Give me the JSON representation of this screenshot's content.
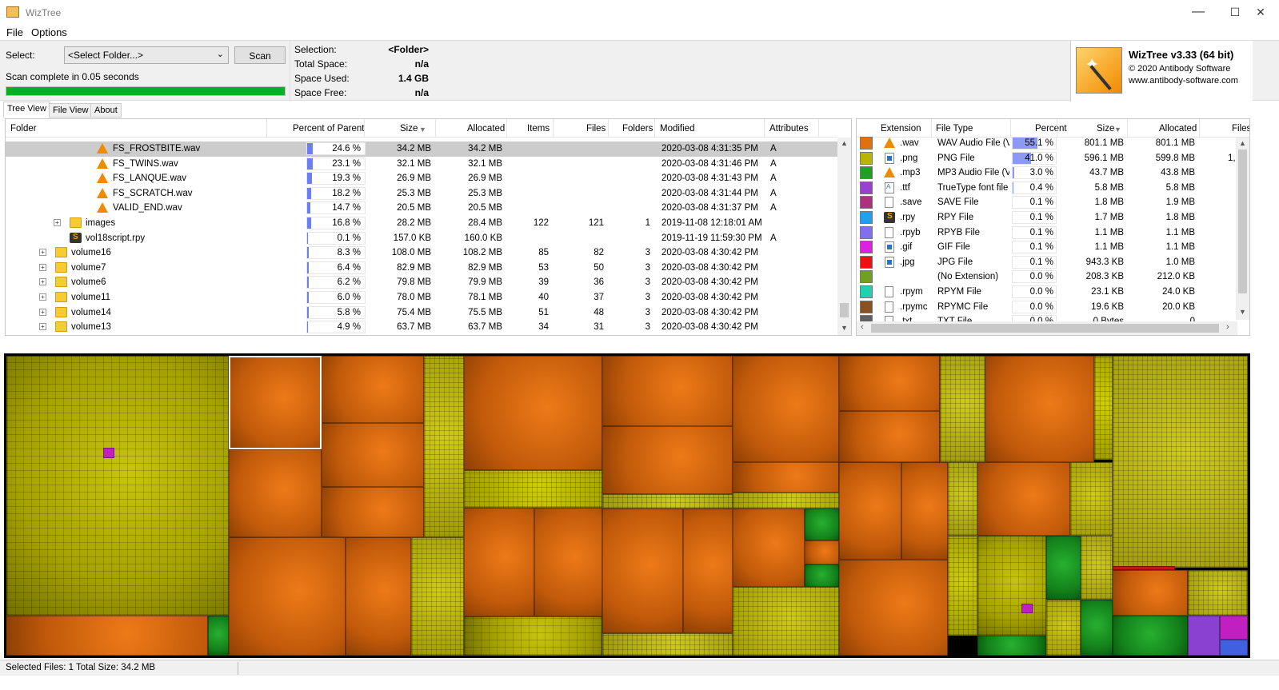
{
  "window": {
    "title": "WizTree",
    "minimize": "—",
    "maximize": "☐",
    "close": "✕"
  },
  "menu": [
    "File",
    "Options"
  ],
  "toolbar": {
    "select_label": "Select:",
    "folder_value": "<Select Folder...>",
    "scan_label": "Scan",
    "status": "Scan complete in 0.05 seconds",
    "progress_fraction": 1.0
  },
  "info": {
    "selection_label": "Selection:",
    "selection_value": "<Folder>",
    "total_label": "Total Space:",
    "total_value": "n/a",
    "used_label": "Space Used:",
    "used_value": "1.4 GB",
    "free_label": "Space Free:",
    "free_value": "n/a"
  },
  "about": {
    "title": "WizTree v3.33 (64 bit)",
    "copyright": "© 2020 Antibody Software",
    "url": "www.antibody-software.com"
  },
  "tabs": [
    "Tree View",
    "File View",
    "About"
  ],
  "tree": {
    "headers": [
      "Folder",
      "Percent of Parent",
      "Size",
      "Allocated",
      "Items",
      "Files",
      "Folders",
      "Modified",
      "Attributes"
    ],
    "rows": [
      {
        "name": "FS_FROSTBITE.wav",
        "icon": "vlc-icon",
        "pct": "24.6 %",
        "pctv": 24.6,
        "size": "34.2 MB",
        "alloc": "34.2 MB",
        "items": "",
        "files": "",
        "folders": "",
        "modified": "2020-03-08 4:31:35 PM",
        "attr": "A",
        "selected": true
      },
      {
        "name": "FS_TWINS.wav",
        "icon": "vlc-icon",
        "pct": "23.1 %",
        "pctv": 23.1,
        "size": "32.1 MB",
        "alloc": "32.1 MB",
        "items": "",
        "files": "",
        "folders": "",
        "modified": "2020-03-08 4:31:46 PM",
        "attr": "A"
      },
      {
        "name": "FS_LANQUE.wav",
        "icon": "vlc-icon",
        "pct": "19.3 %",
        "pctv": 19.3,
        "size": "26.9 MB",
        "alloc": "26.9 MB",
        "items": "",
        "files": "",
        "folders": "",
        "modified": "2020-03-08 4:31:43 PM",
        "attr": "A"
      },
      {
        "name": "FS_SCRATCH.wav",
        "icon": "vlc-icon",
        "pct": "18.2 %",
        "pctv": 18.2,
        "size": "25.3 MB",
        "alloc": "25.3 MB",
        "items": "",
        "files": "",
        "folders": "",
        "modified": "2020-03-08 4:31:44 PM",
        "attr": "A"
      },
      {
        "name": "VALID_END.wav",
        "icon": "vlc-icon",
        "pct": "14.7 %",
        "pctv": 14.7,
        "size": "20.5 MB",
        "alloc": "20.5 MB",
        "items": "",
        "files": "",
        "folders": "",
        "modified": "2020-03-08 4:31:37 PM",
        "attr": "A"
      },
      {
        "name": "images",
        "icon": "folder-icon",
        "pct": "16.8 %",
        "pctv": 16.8,
        "size": "28.2 MB",
        "alloc": "28.4 MB",
        "items": "122",
        "files": "121",
        "folders": "1",
        "modified": "2019-11-08 12:18:01 AM",
        "attr": ""
      },
      {
        "name": "vol18script.rpy",
        "icon": "py-icon",
        "pct": "0.1 %",
        "pctv": 0.1,
        "size": "157.0 KB",
        "alloc": "160.0 KB",
        "items": "",
        "files": "",
        "folders": "",
        "modified": "2019-11-19 11:59:30 PM",
        "attr": "A"
      },
      {
        "name": "volume16",
        "icon": "folder-icon",
        "pct": "8.3 %",
        "pctv": 8.3,
        "size": "108.0 MB",
        "alloc": "108.2 MB",
        "items": "85",
        "files": "82",
        "folders": "3",
        "modified": "2020-03-08 4:30:42 PM",
        "attr": ""
      },
      {
        "name": "volume7",
        "icon": "folder-icon",
        "pct": "6.4 %",
        "pctv": 6.4,
        "size": "82.9 MB",
        "alloc": "82.9 MB",
        "items": "53",
        "files": "50",
        "folders": "3",
        "modified": "2020-03-08 4:30:42 PM",
        "attr": ""
      },
      {
        "name": "volume6",
        "icon": "folder-icon",
        "pct": "6.2 %",
        "pctv": 6.2,
        "size": "79.8 MB",
        "alloc": "79.9 MB",
        "items": "39",
        "files": "36",
        "folders": "3",
        "modified": "2020-03-08 4:30:42 PM",
        "attr": ""
      },
      {
        "name": "volume11",
        "icon": "folder-icon",
        "pct": "6.0 %",
        "pctv": 6.0,
        "size": "78.0 MB",
        "alloc": "78.1 MB",
        "items": "40",
        "files": "37",
        "folders": "3",
        "modified": "2020-03-08 4:30:42 PM",
        "attr": ""
      },
      {
        "name": "volume14",
        "icon": "folder-icon",
        "pct": "5.8 %",
        "pctv": 5.8,
        "size": "75.4 MB",
        "alloc": "75.5 MB",
        "items": "51",
        "files": "48",
        "folders": "3",
        "modified": "2020-03-08 4:30:42 PM",
        "attr": ""
      },
      {
        "name": "volume13",
        "icon": "folder-icon",
        "pct": "4.9 %",
        "pctv": 4.9,
        "size": "63.7 MB",
        "alloc": "63.7 MB",
        "items": "34",
        "files": "31",
        "folders": "3",
        "modified": "2020-03-08 4:30:42 PM",
        "attr": ""
      }
    ]
  },
  "extensions": {
    "headers": [
      "Extension",
      "File Type",
      "Percent",
      "Size",
      "Allocated",
      "Files"
    ],
    "rows": [
      {
        "color": "#e07010",
        "icon": "vlc-icon",
        "ext": ".wav",
        "type": "WAV Audio File (VL",
        "pct": "55.1 %",
        "pctv": 55.1,
        "size": "801.1 MB",
        "alloc": "801.1 MB",
        "files": ""
      },
      {
        "color": "#b8b400",
        "icon": "image-icon",
        "ext": ".png",
        "type": "PNG File",
        "pct": "41.0 %",
        "pctv": 41.0,
        "size": "596.1 MB",
        "alloc": "599.8 MB",
        "files": "1,"
      },
      {
        "color": "#20a020",
        "icon": "vlc-icon",
        "ext": ".mp3",
        "type": "MP3 Audio File (VL",
        "pct": "3.0 %",
        "pctv": 3.0,
        "size": "43.7 MB",
        "alloc": "43.8 MB",
        "files": ""
      },
      {
        "color": "#9a40d0",
        "icon": "font-icon",
        "ext": ".ttf",
        "type": "TrueType font file",
        "pct": "0.4 %",
        "pctv": 0.4,
        "size": "5.8 MB",
        "alloc": "5.8 MB",
        "files": ""
      },
      {
        "color": "#b03080",
        "icon": "file-icon",
        "ext": ".save",
        "type": "SAVE File",
        "pct": "0.1 %",
        "pctv": 0.1,
        "size": "1.8 MB",
        "alloc": "1.9 MB",
        "files": ""
      },
      {
        "color": "#20a0f0",
        "icon": "py-icon",
        "ext": ".rpy",
        "type": "RPY File",
        "pct": "0.1 %",
        "pctv": 0.1,
        "size": "1.7 MB",
        "alloc": "1.8 MB",
        "files": ""
      },
      {
        "color": "#8070f0",
        "icon": "file-icon",
        "ext": ".rpyb",
        "type": "RPYB File",
        "pct": "0.1 %",
        "pctv": 0.1,
        "size": "1.1 MB",
        "alloc": "1.1 MB",
        "files": ""
      },
      {
        "color": "#e020e0",
        "icon": "image-icon",
        "ext": ".gif",
        "type": "GIF File",
        "pct": "0.1 %",
        "pctv": 0.1,
        "size": "1.1 MB",
        "alloc": "1.1 MB",
        "files": ""
      },
      {
        "color": "#f01010",
        "icon": "image-icon",
        "ext": ".jpg",
        "type": "JPG File",
        "pct": "0.1 %",
        "pctv": 0.1,
        "size": "943.3 KB",
        "alloc": "1.0 MB",
        "files": ""
      },
      {
        "color": "#70a020",
        "icon": "",
        "ext": "",
        "type": "(No Extension)",
        "pct": "0.0 %",
        "pctv": 0,
        "size": "208.3 KB",
        "alloc": "212.0 KB",
        "files": ""
      },
      {
        "color": "#20d0b0",
        "icon": "file-icon",
        "ext": ".rpym",
        "type": "RPYM File",
        "pct": "0.0 %",
        "pctv": 0,
        "size": "23.1 KB",
        "alloc": "24.0 KB",
        "files": ""
      },
      {
        "color": "#8a5020",
        "icon": "file-icon",
        "ext": ".rpymc",
        "type": "RPYMC File",
        "pct": "0.0 %",
        "pctv": 0,
        "size": "19.6 KB",
        "alloc": "20.0 KB",
        "files": ""
      },
      {
        "color": "#606060",
        "icon": "file-icon",
        "ext": ".txt",
        "type": "TXT File",
        "pct": "0.0 %",
        "pctv": 0,
        "size": "0 Bytes",
        "alloc": "0",
        "files": ""
      }
    ]
  },
  "status": {
    "text": "Selected Files: 1  Total Size: 34.2 MB"
  }
}
